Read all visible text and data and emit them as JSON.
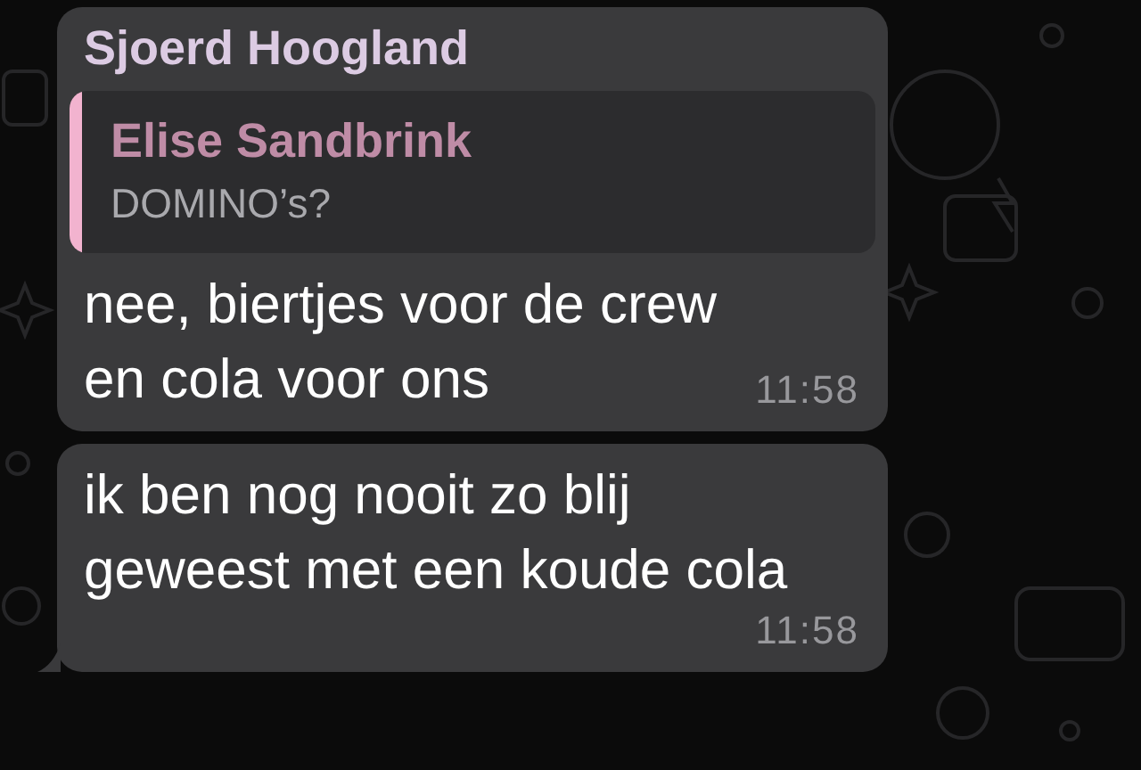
{
  "messages": [
    {
      "sender": "Sjoerd Hoogland",
      "quote": {
        "author": "Elise Sandbrink",
        "text": "DOMINO’s?"
      },
      "text": "nee, biertjes voor de crew\nen cola voor ons",
      "time": "11:58",
      "tail": false
    },
    {
      "text": "ik ben nog nooit zo blij\ngeweest met een koude cola",
      "time": "11:58",
      "tail": true
    }
  ]
}
